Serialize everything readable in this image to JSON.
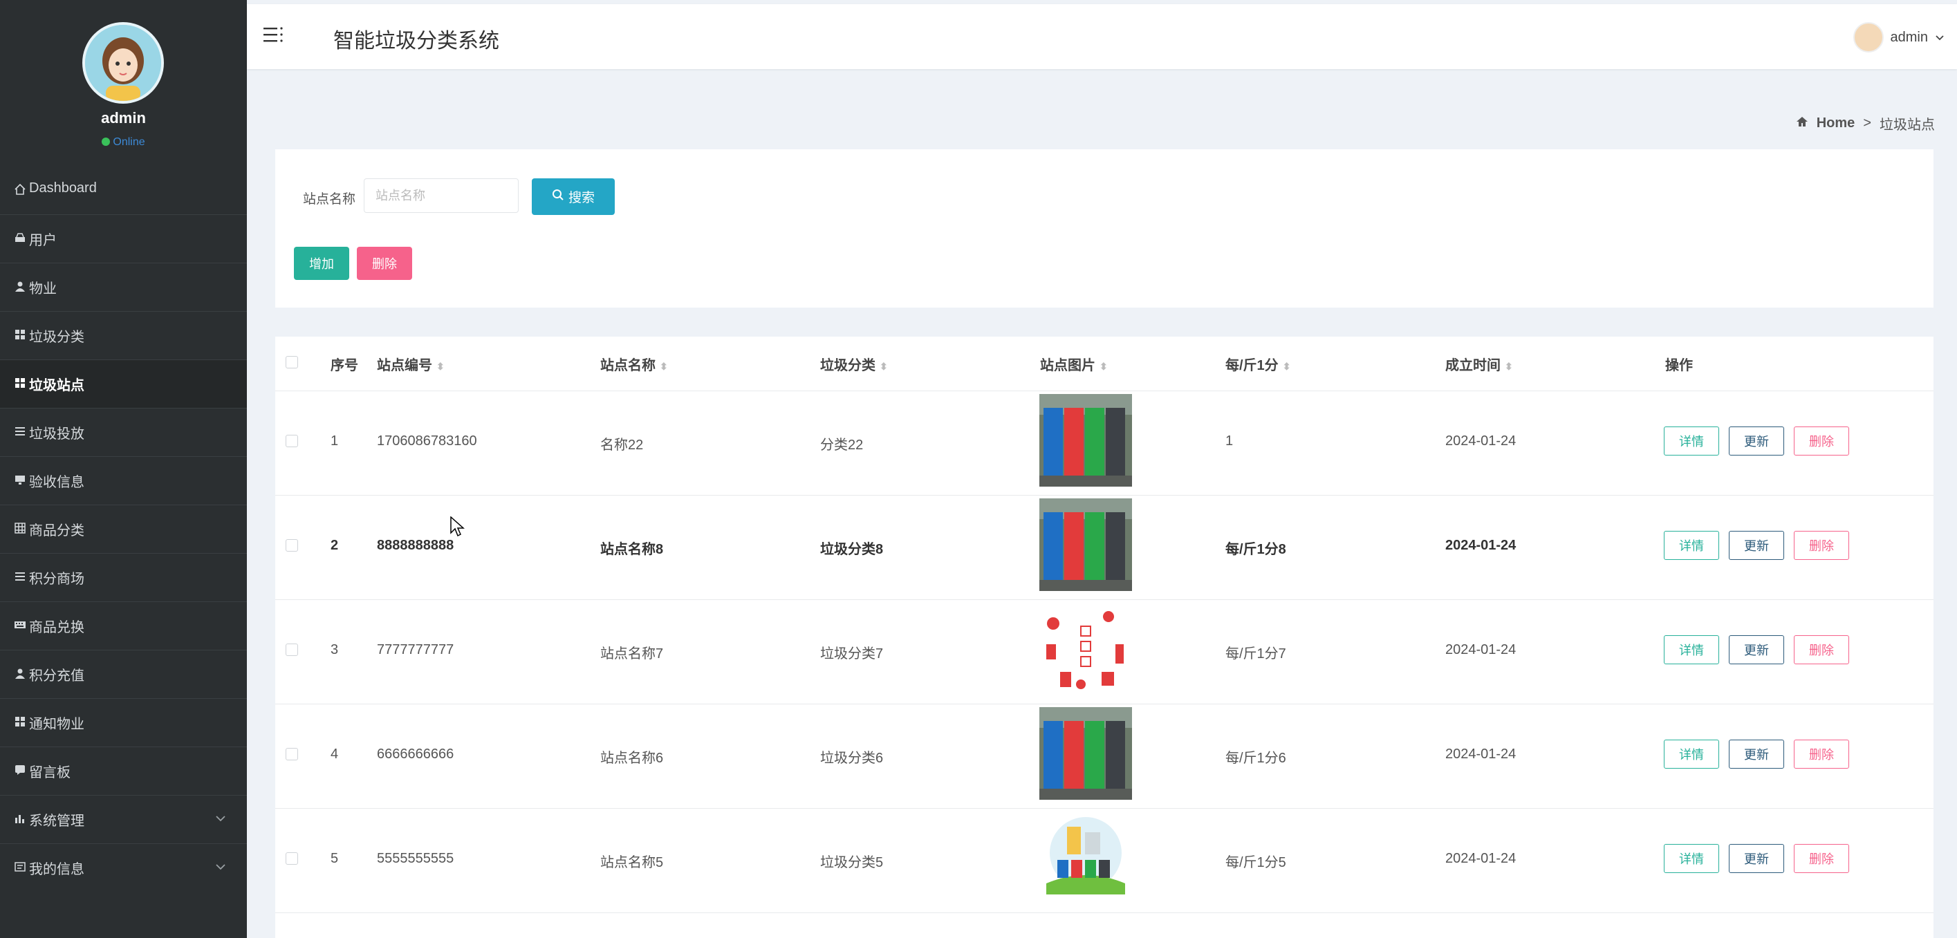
{
  "sidebar": {
    "profile": {
      "name": "admin",
      "status": "Online"
    },
    "items": [
      {
        "label": "Dashboard"
      },
      {
        "label": "用户"
      },
      {
        "label": "物业"
      },
      {
        "label": "垃圾分类"
      },
      {
        "label": "垃圾站点"
      },
      {
        "label": "垃圾投放"
      },
      {
        "label": "验收信息"
      },
      {
        "label": "商品分类"
      },
      {
        "label": "积分商场"
      },
      {
        "label": "商品兑换"
      },
      {
        "label": "积分充值"
      },
      {
        "label": "通知物业"
      },
      {
        "label": "留言板"
      },
      {
        "label": "系统管理"
      },
      {
        "label": "我的信息"
      }
    ]
  },
  "header": {
    "title": "智能垃圾分类系统",
    "user": "admin"
  },
  "breadcrumb": {
    "home": "Home",
    "separator": ">",
    "current": "垃圾站点"
  },
  "search": {
    "label": "站点名称",
    "placeholder": "站点名称",
    "button": "搜索"
  },
  "toolbar": {
    "add": "增加",
    "delete": "删除"
  },
  "table": {
    "headers": {
      "index": "序号",
      "code": "站点编号",
      "name": "站点名称",
      "category": "垃圾分类",
      "image": "站点图片",
      "points": "每/斤1分",
      "date": "成立时间",
      "actions": "操作"
    },
    "actions": {
      "detail": "详情",
      "update": "更新",
      "delete": "删除"
    },
    "rows": [
      {
        "index": "1",
        "code": "1706086783160",
        "name": "名称22",
        "category": "分类22",
        "points": "1",
        "date": "2024-01-24"
      },
      {
        "index": "2",
        "code": "8888888888",
        "name": "站点名称8",
        "category": "垃圾分类8",
        "points": "每/斤1分8",
        "date": "2024-01-24"
      },
      {
        "index": "3",
        "code": "7777777777",
        "name": "站点名称7",
        "category": "垃圾分类7",
        "points": "每/斤1分7",
        "date": "2024-01-24"
      },
      {
        "index": "4",
        "code": "6666666666",
        "name": "站点名称6",
        "category": "垃圾分类6",
        "points": "每/斤1分6",
        "date": "2024-01-24"
      },
      {
        "index": "5",
        "code": "5555555555",
        "name": "站点名称5",
        "category": "垃圾分类5",
        "points": "每/斤1分5",
        "date": "2024-01-24"
      }
    ]
  },
  "colors": {
    "sidebar": "#2b2f31",
    "primary": "#24a6c6",
    "success": "#27b19a",
    "danger": "#f6628b",
    "update": "#2c5a7a"
  },
  "icons": [
    "menu-icon",
    "home-icon",
    "user-icon",
    "grid-icon",
    "list-icon",
    "search-icon",
    "chevron-down-icon",
    "comment-icon",
    "chart-icon"
  ]
}
